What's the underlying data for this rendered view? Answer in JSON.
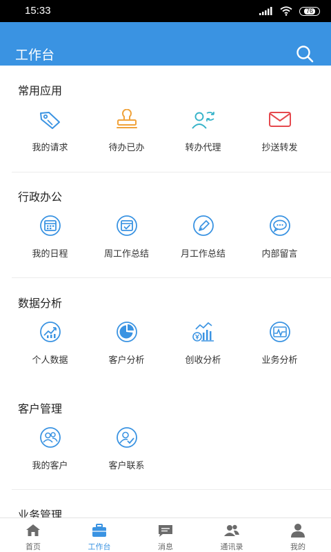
{
  "status": {
    "time": "15:33",
    "battery": "76"
  },
  "header": {
    "title": "工作台"
  },
  "sections": [
    {
      "title": "常用应用",
      "items": [
        {
          "label": "我的请求",
          "icon": "tag-icon"
        },
        {
          "label": "待办已办",
          "icon": "stamp-icon"
        },
        {
          "label": "转办代理",
          "icon": "user-transfer-icon"
        },
        {
          "label": "抄送转发",
          "icon": "envelope-icon"
        }
      ]
    },
    {
      "title": "行政办公",
      "items": [
        {
          "label": "我的日程",
          "icon": "calendar-icon"
        },
        {
          "label": "周工作总结",
          "icon": "calendar-check-icon"
        },
        {
          "label": "月工作总结",
          "icon": "pen-icon"
        },
        {
          "label": "内部留言",
          "icon": "chat-bubble-icon"
        }
      ]
    },
    {
      "title": "数据分析",
      "items": [
        {
          "label": "个人数据",
          "icon": "trend-chart-icon"
        },
        {
          "label": "客户分析",
          "icon": "pie-chart-icon"
        },
        {
          "label": "创收分析",
          "icon": "revenue-chart-icon"
        },
        {
          "label": "业务分析",
          "icon": "pulse-chart-icon"
        }
      ]
    },
    {
      "title": "客户管理",
      "items": [
        {
          "label": "我的客户",
          "icon": "customers-icon"
        },
        {
          "label": "客户联系",
          "icon": "customer-contact-icon"
        }
      ]
    },
    {
      "title": "业务管理",
      "items": []
    }
  ],
  "tabs": [
    {
      "label": "首页",
      "icon": "home-icon",
      "active": false
    },
    {
      "label": "工作台",
      "icon": "briefcase-icon",
      "active": true
    },
    {
      "label": "消息",
      "icon": "message-icon",
      "active": false
    },
    {
      "label": "通讯录",
      "icon": "contacts-icon",
      "active": false
    },
    {
      "label": "我的",
      "icon": "profile-icon",
      "active": false
    }
  ],
  "colors": {
    "primary": "#3a93e2",
    "orange": "#f0a23a",
    "red": "#e5484d",
    "teal": "#36b3c9",
    "tab_gray": "#6b6b6b"
  }
}
